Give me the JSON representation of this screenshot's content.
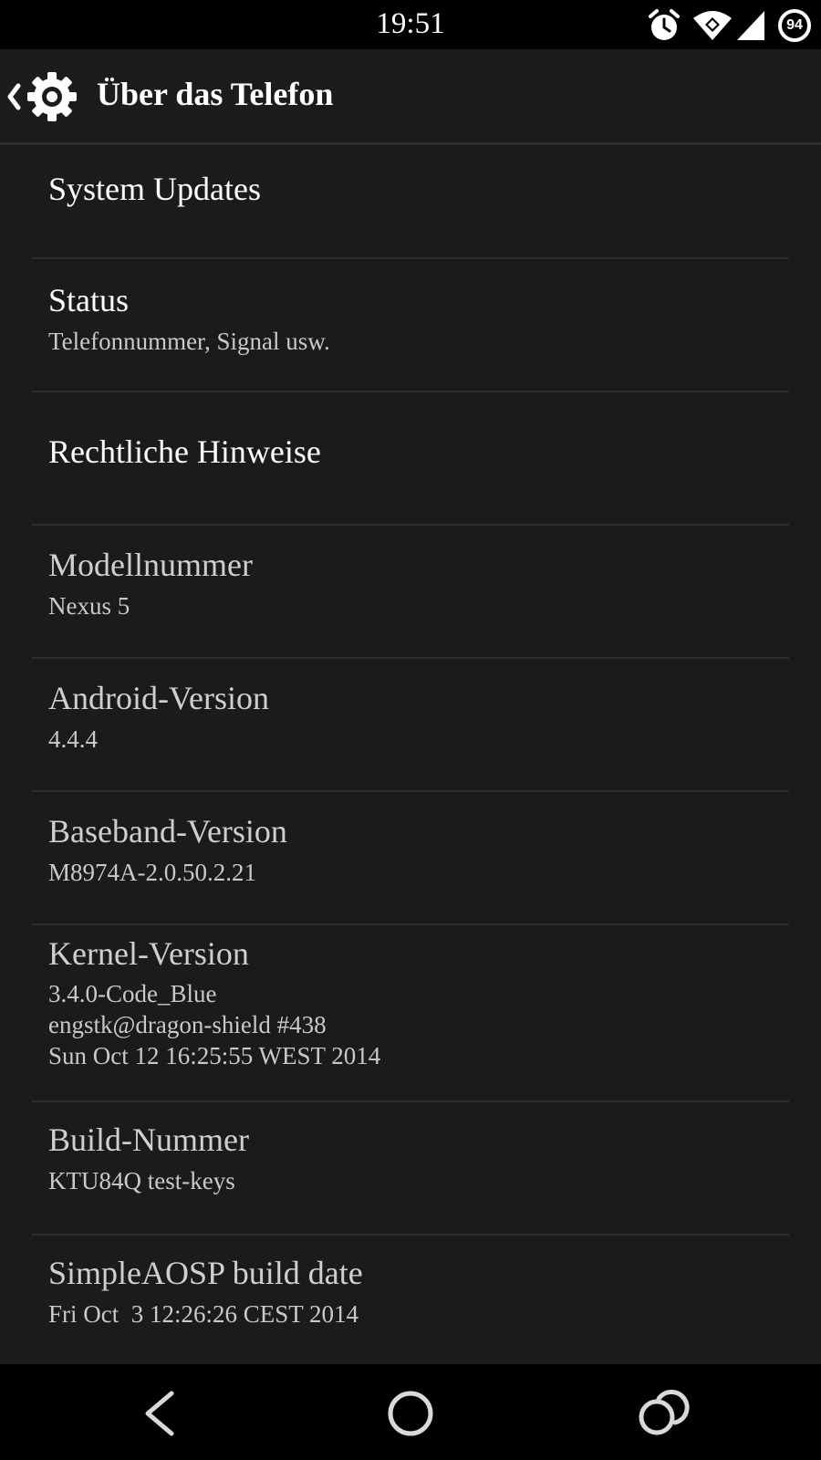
{
  "status_bar": {
    "time": "19:51",
    "battery_level": "94",
    "icons": [
      "alarm-clock-icon",
      "wifi-icon",
      "cell-signal-icon",
      "battery-circle-icon"
    ]
  },
  "action_bar": {
    "title": "Über das Telefon",
    "icons": [
      "chevron-left-icon",
      "gear-icon"
    ]
  },
  "settings": {
    "system_updates": {
      "title": "System Updates"
    },
    "status": {
      "title": "Status",
      "summary": "Telefonnummer, Signal usw."
    },
    "legal": {
      "title": "Rechtliche Hinweise"
    },
    "model": {
      "title": "Modellnummer",
      "summary": "Nexus 5"
    },
    "android_version": {
      "title": "Android-Version",
      "summary": "4.4.4"
    },
    "baseband": {
      "title": "Baseband-Version",
      "summary": "M8974A-2.0.50.2.21"
    },
    "kernel": {
      "title": "Kernel-Version",
      "summary_lines": [
        "3.4.0-Code_Blue",
        "engstk@dragon-shield #438",
        "Sun Oct 12 16:25:55 WEST 2014"
      ]
    },
    "build_number": {
      "title": "Build-Nummer",
      "summary": "KTU84Q test-keys"
    },
    "simpleaosp_build_date": {
      "title": "SimpleAOSP build date",
      "summary": "Fri Oct  3 12:26:26 CEST 2014"
    }
  },
  "nav_bar": {
    "icons": [
      "back-icon",
      "home-icon",
      "recents-icon"
    ]
  },
  "colors": {
    "background": "#1b1b1b",
    "action_bar": "#1c1c1c",
    "system_bars": "#000000",
    "divider": "#2f2f2f",
    "primary_text": "#ffffff",
    "secondary_text": "#c9c9c9"
  }
}
